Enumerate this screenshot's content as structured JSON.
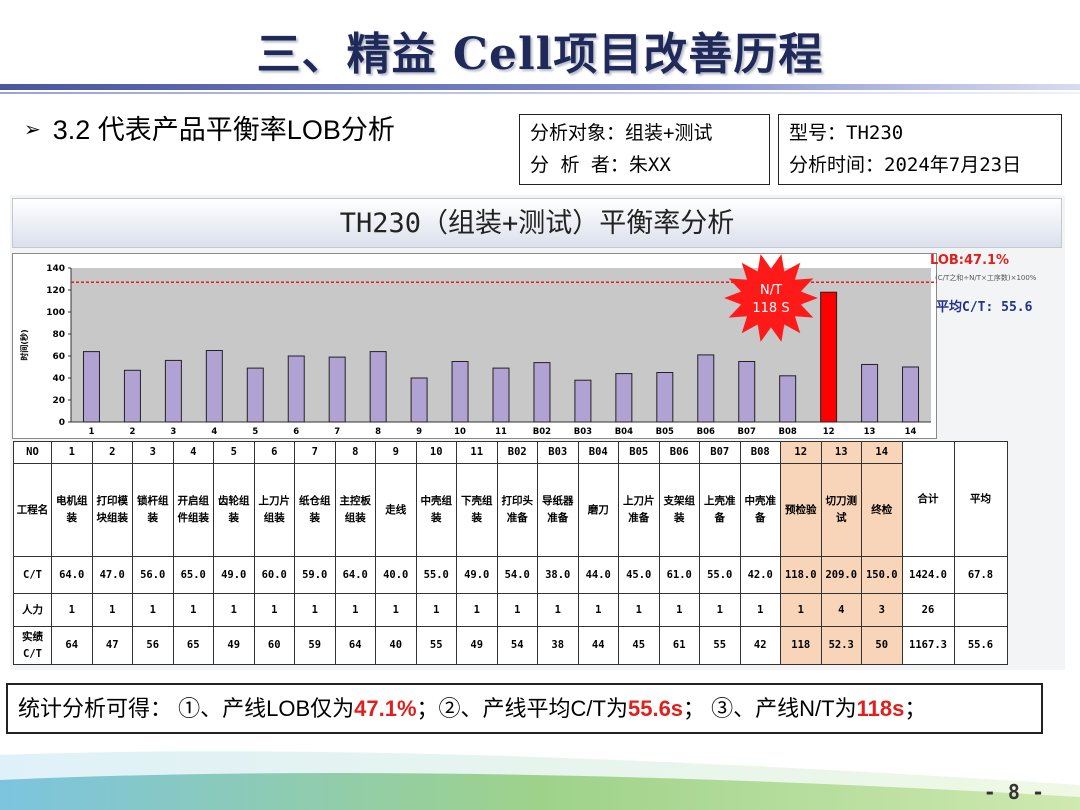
{
  "title": "三、精益 Cell项目改善历程",
  "section": {
    "arrow": "➢",
    "heading": "3.2  代表产品平衡率LOB分析"
  },
  "info_left": {
    "line1": "分析对象：组装+测试",
    "line2": "分 析 者：朱XX"
  },
  "info_right": {
    "line1": "型号：TH230",
    "line2": "分析时间：2024年7月23日"
  },
  "chart_title": "TH230（组装+测试）平衡率分析",
  "lob_label": "LOB:47.1%",
  "lob_note": "(C/T之和÷N/T×工序数)×100%",
  "avg_label": "平均C/T: 55.6",
  "burst": {
    "line1": "N/T",
    "line2": "118 S"
  },
  "chart_data": {
    "type": "bar",
    "title": "TH230（组装+测试）平衡率分析",
    "ylabel": "时间(秒)",
    "xlabel": "",
    "ylim": [
      0,
      140
    ],
    "yticks": [
      "0",
      "20",
      "40",
      "60",
      "80",
      "100",
      "120",
      "140"
    ],
    "categories": [
      "1",
      "2",
      "3",
      "4",
      "5",
      "6",
      "7",
      "8",
      "9",
      "10",
      "11",
      "B02",
      "B03",
      "B04",
      "B05",
      "B06",
      "B07",
      "B08",
      "12",
      "13",
      "14"
    ],
    "values": [
      64,
      47,
      56,
      65,
      49,
      60,
      59,
      64,
      40,
      55,
      49,
      54,
      38,
      44,
      45,
      61,
      55,
      42,
      118,
      52.3,
      50
    ],
    "highlight_index": 18,
    "nt_line": 127,
    "grid": false,
    "colors": {
      "bar": "#b0a2d2",
      "bar_edge": "#222222",
      "highlight": "#ff0000",
      "plot_bg": "#c8c8c8",
      "nt_line": "#e0201c"
    }
  },
  "table": {
    "headers": {
      "no": "NO",
      "name": "工程名",
      "ct": "C/T",
      "manpower": "人力",
      "actual": "实绩C/T",
      "total": "合计",
      "average": "平均"
    },
    "stations": [
      {
        "no": "1",
        "name": "电机组装",
        "ct": "64.0",
        "man": "1",
        "act": "64"
      },
      {
        "no": "2",
        "name": "打印模块组装",
        "ct": "47.0",
        "man": "1",
        "act": "47"
      },
      {
        "no": "3",
        "name": "锁杆组装",
        "ct": "56.0",
        "man": "1",
        "act": "56"
      },
      {
        "no": "4",
        "name": "开启组件组装",
        "ct": "65.0",
        "man": "1",
        "act": "65"
      },
      {
        "no": "5",
        "name": "齿轮组装",
        "ct": "49.0",
        "man": "1",
        "act": "49"
      },
      {
        "no": "6",
        "name": "上刀片组装",
        "ct": "60.0",
        "man": "1",
        "act": "60"
      },
      {
        "no": "7",
        "name": "纸仓组装",
        "ct": "59.0",
        "man": "1",
        "act": "59"
      },
      {
        "no": "8",
        "name": "主控板组装",
        "ct": "64.0",
        "man": "1",
        "act": "64"
      },
      {
        "no": "9",
        "name": "走线",
        "ct": "40.0",
        "man": "1",
        "act": "40"
      },
      {
        "no": "10",
        "name": "中壳组装",
        "ct": "55.0",
        "man": "1",
        "act": "55"
      },
      {
        "no": "11",
        "name": "下壳组装",
        "ct": "49.0",
        "man": "1",
        "act": "49"
      },
      {
        "no": "B02",
        "name": "打印头准备",
        "ct": "54.0",
        "man": "1",
        "act": "54"
      },
      {
        "no": "B03",
        "name": "导纸器准备",
        "ct": "38.0",
        "man": "1",
        "act": "38"
      },
      {
        "no": "B04",
        "name": "磨刀",
        "ct": "44.0",
        "man": "1",
        "act": "44"
      },
      {
        "no": "B05",
        "name": "上刀片准备",
        "ct": "45.0",
        "man": "1",
        "act": "45"
      },
      {
        "no": "B06",
        "name": "支架组装",
        "ct": "61.0",
        "man": "1",
        "act": "61"
      },
      {
        "no": "B07",
        "name": "上壳准备",
        "ct": "55.0",
        "man": "1",
        "act": "55"
      },
      {
        "no": "B08",
        "name": "中壳准备",
        "ct": "42.0",
        "man": "1",
        "act": "42"
      },
      {
        "no": "12",
        "name": "预检验",
        "ct": "118.0",
        "man": "1",
        "act": "118",
        "hl": true
      },
      {
        "no": "13",
        "name": "切刀测试",
        "ct": "209.0",
        "man": "4",
        "act": "52.3",
        "hl": true
      },
      {
        "no": "14",
        "name": "终检",
        "ct": "150.0",
        "man": "3",
        "act": "50",
        "hl": true
      }
    ],
    "totals": {
      "ct_total": "1424.0",
      "ct_avg": "67.8",
      "man_total": "26",
      "man_avg": "",
      "act_total": "1167.3",
      "act_avg": "55.6"
    }
  },
  "summary": {
    "prefix": "统计分析可得：  ①、产线LOB仅为",
    "lob": "47.1%",
    "mid1": "；②、产线平均C/T为",
    "avg": "55.6s",
    "mid2": "；  ③、产线N/T为",
    "nt": "118s",
    "end": "；"
  },
  "page_number": "- 8 -"
}
